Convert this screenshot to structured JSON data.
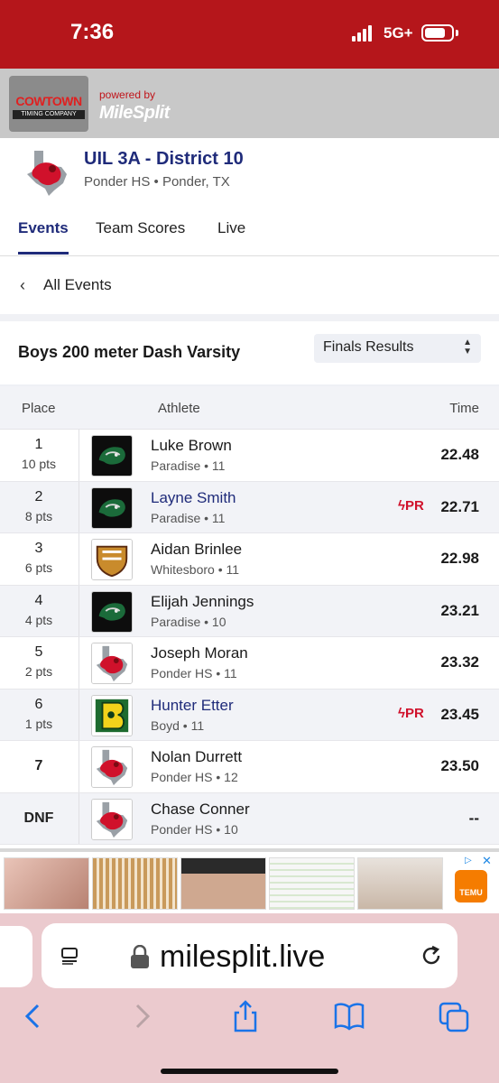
{
  "status": {
    "time": "7:36",
    "network": "5G+"
  },
  "brand": {
    "logo_line1": "COWTOWN",
    "logo_line2": "TIMING COMPANY",
    "powered_by": "powered by",
    "milesplit": "MileSplit"
  },
  "meet": {
    "title": "UIL 3A - District 10",
    "subtitle": "Ponder HS • Ponder, TX"
  },
  "tabs": [
    {
      "label": "Events",
      "active": true
    },
    {
      "label": "Team Scores",
      "active": false
    },
    {
      "label": "Live",
      "active": false
    }
  ],
  "nav": {
    "all_events": "All Events"
  },
  "event": {
    "title": "Boys 200 meter Dash Varsity",
    "results_select": "Finals Results"
  },
  "table": {
    "headers": {
      "place": "Place",
      "athlete": "Athlete",
      "time": "Time"
    },
    "rows": [
      {
        "place": "1",
        "pts": "10 pts",
        "name": "Luke Brown",
        "school": "Paradise • 11",
        "time": "22.48",
        "pr": "",
        "team_icon": "panther-logo"
      },
      {
        "place": "2",
        "pts": "8 pts",
        "name": "Layne Smith",
        "school": "Paradise • 11",
        "time": "22.71",
        "pr": "PR",
        "team_icon": "panther-logo"
      },
      {
        "place": "3",
        "pts": "6 pts",
        "name": "Aidan Brinlee",
        "school": "Whitesboro • 11",
        "time": "22.98",
        "pr": "",
        "team_icon": "whitesboro-logo"
      },
      {
        "place": "4",
        "pts": "4 pts",
        "name": "Elijah Jennings",
        "school": "Paradise • 10",
        "time": "23.21",
        "pr": "",
        "team_icon": "panther-logo"
      },
      {
        "place": "5",
        "pts": "2 pts",
        "name": "Joseph Moran",
        "school": "Ponder HS • 11",
        "time": "23.32",
        "pr": "",
        "team_icon": "ponder-lion-logo"
      },
      {
        "place": "6",
        "pts": "1 pts",
        "name": "Hunter Etter",
        "school": "Boyd • 11",
        "time": "23.45",
        "pr": "PR",
        "team_icon": "boyd-yellowjacket-logo"
      },
      {
        "place": "7",
        "pts": "",
        "name": "Nolan Durrett",
        "school": "Ponder HS • 12",
        "time": "23.50",
        "pr": "",
        "team_icon": "ponder-lion-logo"
      },
      {
        "place": "DNF",
        "pts": "",
        "name": "Chase Conner",
        "school": "Ponder HS • 10",
        "time": "--",
        "pr": "",
        "team_icon": "ponder-lion-logo"
      }
    ]
  },
  "ad": {
    "temu_label": "TEMU"
  },
  "browser": {
    "url": "milesplit.live"
  },
  "colors": {
    "status_bar": "#b5161b",
    "link_blue": "#1f2b7a",
    "pr_red": "#d0112b",
    "browser_bg": "#ebcace"
  }
}
